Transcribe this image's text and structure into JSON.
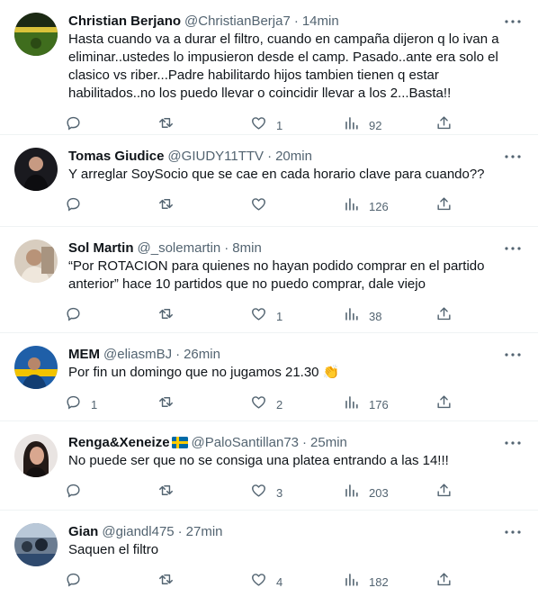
{
  "tweets": [
    {
      "name": "Christian Berjano",
      "handle": "@ChristianBerja7",
      "time": "14min",
      "text": "Hasta cuando va a durar el filtro, cuando en campaña dijeron q lo ivan a eliminar..ustedes lo impusieron desde el camp. Pasado..ante era solo el clasico vs riber...Padre habilitardo hijos tambien tienen q estar habilitados..no los puedo llevar o coincidir llevar a los 2...Basta!!",
      "replies": "",
      "retweets": "",
      "likes": "1",
      "views": "92"
    },
    {
      "name": "Tomas Giudice",
      "handle": "@GIUDY11TTV",
      "time": "20min",
      "text": "Y arreglar SoySocio que se cae en cada horario clave para cuando??",
      "replies": "",
      "retweets": "",
      "likes": "",
      "views": "126"
    },
    {
      "name": "Sol Martin",
      "handle": "@_solemartin",
      "time": "8min",
      "text": "“Por ROTACION para quienes no hayan podido comprar en el partido anterior” hace 10 partidos que no puedo comprar, dale viejo",
      "replies": "",
      "retweets": "",
      "likes": "1",
      "views": "38"
    },
    {
      "name": "MEM",
      "handle": "@eliasmBJ",
      "time": "26min",
      "text": "Por fin un domingo que no jugamos 21.30 👏",
      "replies": "1",
      "retweets": "",
      "likes": "2",
      "views": "176"
    },
    {
      "name": "Renga&Xeneize",
      "handle": "@PaloSantillan73",
      "time": "25min",
      "text": "No puede ser que no se consiga una platea entrando a las 14!!!",
      "replies": "",
      "retweets": "",
      "likes": "3",
      "views": "203"
    },
    {
      "name": "Gian",
      "handle": "@giandl475",
      "time": "27min",
      "text": "Saquen el filtro",
      "replies": "",
      "retweets": "",
      "likes": "4",
      "views": "182"
    }
  ],
  "separator": "·",
  "icons": {
    "more": "more-dots-icon",
    "reply": "reply-bubble-icon",
    "retweet": "retweet-arrows-icon",
    "like": "heart-icon",
    "views": "views-bar-chart-icon",
    "share": "share-upload-icon",
    "flag": "sweden-flag-icon"
  },
  "colors": {
    "text": "#0f1419",
    "secondary": "#536471",
    "divider": "#eff3f4",
    "flag_blue": "#006aa7",
    "flag_yellow": "#fecc00"
  }
}
